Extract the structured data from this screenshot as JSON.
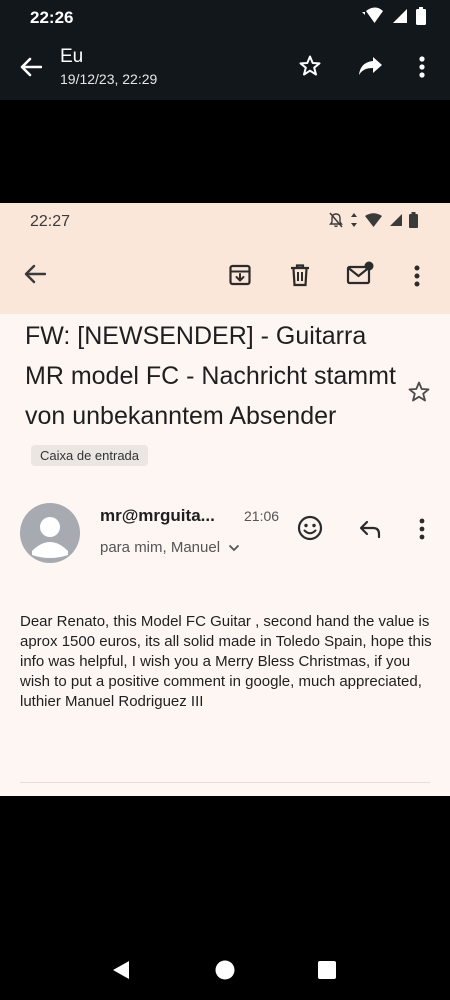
{
  "outer_status": {
    "time": "22:26"
  },
  "outer_toolbar": {
    "title": "Eu",
    "subtitle": "19/12/23, 22:29"
  },
  "inner_status": {
    "time": "22:27"
  },
  "email": {
    "subject": "FW: [NEWSENDER] - Guitarra MR model FC - Nachricht stammt von unbekanntem Absender",
    "label": "Caixa de entrada",
    "sender": "mr@mrguita...",
    "time": "21:06",
    "recipients": "para mim, Manuel",
    "body": "Dear Renato, this Model FC Guitar , second hand the value is aprox 1500 euros, its all solid made in Toledo Spain, hope this info was helpful, I wish you a Merry Bless Christmas, if you wish to put a positive comment in google, much appreciated, luthier Manuel Rodriguez III"
  },
  "icons": {
    "outer": [
      "wifi-icon",
      "signal-icon",
      "battery-icon",
      "back-arrow-icon",
      "star-icon",
      "share-icon",
      "more-vert-icon"
    ],
    "inner": [
      "mute-icon",
      "data-icon",
      "wifi-icon",
      "signal-icon",
      "battery-icon",
      "back-arrow-icon",
      "archive-icon",
      "delete-icon",
      "mark-unread-icon",
      "more-vert-icon",
      "star-outline-icon",
      "emoji-icon",
      "reply-icon",
      "more-vert-icon"
    ],
    "nav": [
      "back-triangle-icon",
      "home-circle-icon",
      "recents-square-icon"
    ]
  }
}
